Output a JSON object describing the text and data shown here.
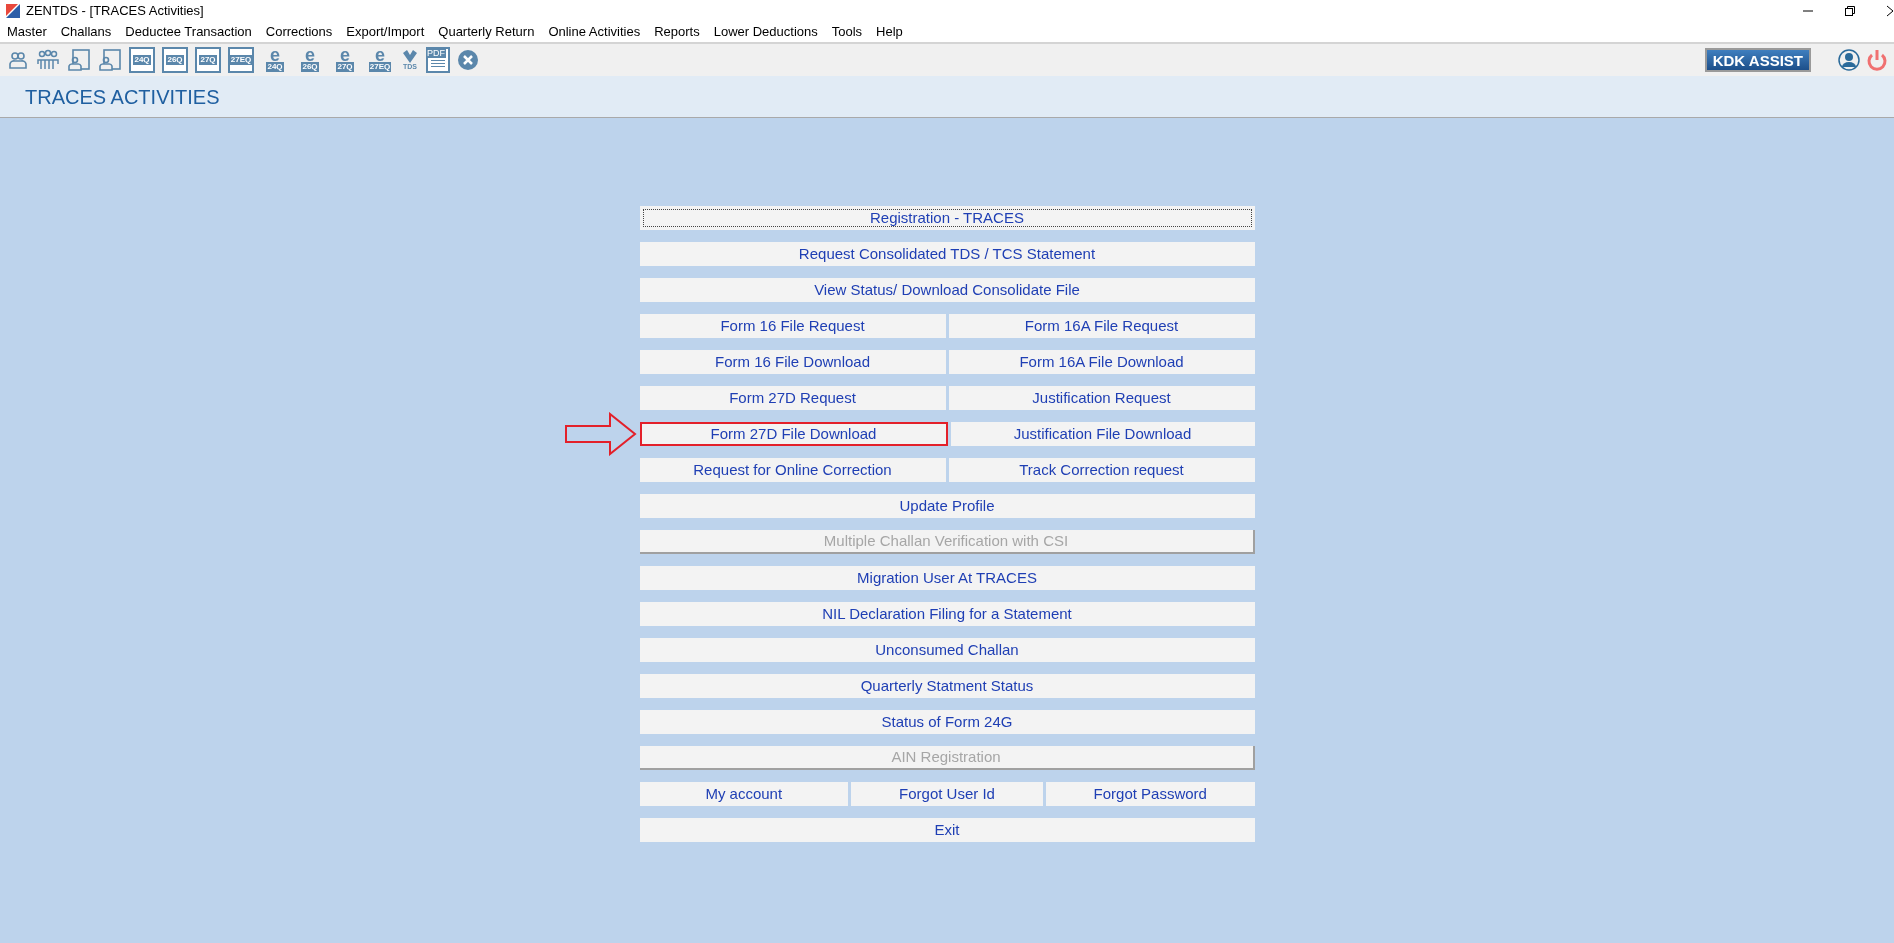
{
  "window": {
    "title": "ZENTDS - [TRACES Activities]"
  },
  "menu": [
    "Master",
    "Challans",
    "Deductee Transaction",
    "Corrections",
    "Export/Import",
    "Quarterly Return",
    "Online Activities",
    "Reports",
    "Lower Deductions",
    "Tools",
    "Help"
  ],
  "toolbar": [
    {
      "kind": "person"
    },
    {
      "kind": "people"
    },
    {
      "kind": "contact"
    },
    {
      "kind": "contact"
    },
    {
      "kind": "form",
      "label": "24Q"
    },
    {
      "kind": "form",
      "label": "26Q"
    },
    {
      "kind": "form",
      "label": "27Q"
    },
    {
      "kind": "form",
      "label": "27EQ"
    },
    {
      "kind": "eform",
      "mark": "e",
      "label": "24Q"
    },
    {
      "kind": "eform",
      "mark": "e",
      "label": "26Q"
    },
    {
      "kind": "eform",
      "mark": "e",
      "label": "27Q"
    },
    {
      "kind": "eform",
      "mark": "e",
      "label": "27EQ"
    },
    {
      "kind": "tds",
      "label": "TDS"
    },
    {
      "kind": "pdf",
      "label": "PDF"
    },
    {
      "kind": "close"
    }
  ],
  "assist_button": "KDK ASSIST",
  "header": {
    "title": "TRACES ACTIVITIES"
  },
  "rows": [
    {
      "buttons": [
        {
          "label": "Registration - TRACES",
          "disabled": false,
          "focused": true,
          "highlighted": false
        }
      ]
    },
    {
      "buttons": [
        {
          "label": "Request Consolidated TDS / TCS Statement",
          "disabled": false,
          "focused": false,
          "highlighted": false
        }
      ]
    },
    {
      "buttons": [
        {
          "label": "View Status/ Download Consolidate File",
          "disabled": false,
          "focused": false,
          "highlighted": false
        }
      ]
    },
    {
      "buttons": [
        {
          "label": "Form 16 File Request",
          "disabled": false,
          "focused": false,
          "highlighted": false
        },
        {
          "label": "Form 16A File Request",
          "disabled": false,
          "focused": false,
          "highlighted": false
        }
      ]
    },
    {
      "buttons": [
        {
          "label": "Form 16 File Download",
          "disabled": false,
          "focused": false,
          "highlighted": false
        },
        {
          "label": "Form 16A File Download",
          "disabled": false,
          "focused": false,
          "highlighted": false
        }
      ]
    },
    {
      "buttons": [
        {
          "label": "Form 27D Request",
          "disabled": false,
          "focused": false,
          "highlighted": false
        },
        {
          "label": "Justification Request",
          "disabled": false,
          "focused": false,
          "highlighted": false
        }
      ]
    },
    {
      "buttons": [
        {
          "label": "Form 27D File Download",
          "disabled": false,
          "focused": false,
          "highlighted": true
        },
        {
          "label": "Justification File Download",
          "disabled": false,
          "focused": false,
          "highlighted": false
        }
      ]
    },
    {
      "buttons": [
        {
          "label": "Request for Online Correction",
          "disabled": false,
          "focused": false,
          "highlighted": false
        },
        {
          "label": "Track Correction request",
          "disabled": false,
          "focused": false,
          "highlighted": false
        }
      ]
    },
    {
      "buttons": [
        {
          "label": "Update Profile",
          "disabled": false,
          "focused": false,
          "highlighted": false
        }
      ]
    },
    {
      "buttons": [
        {
          "label": "Multiple Challan Verification with CSI",
          "disabled": true,
          "focused": false,
          "highlighted": false
        }
      ]
    },
    {
      "buttons": [
        {
          "label": "Migration User At TRACES",
          "disabled": false,
          "focused": false,
          "highlighted": false
        }
      ]
    },
    {
      "buttons": [
        {
          "label": "NIL Declaration Filing for a Statement",
          "disabled": false,
          "focused": false,
          "highlighted": false
        }
      ]
    },
    {
      "buttons": [
        {
          "label": "Unconsumed Challan",
          "disabled": false,
          "focused": false,
          "highlighted": false
        }
      ]
    },
    {
      "buttons": [
        {
          "label": "Quarterly Statment Status",
          "disabled": false,
          "focused": false,
          "highlighted": false
        }
      ]
    },
    {
      "buttons": [
        {
          "label": "Status of Form 24G",
          "disabled": false,
          "focused": false,
          "highlighted": false
        }
      ]
    },
    {
      "buttons": [
        {
          "label": "AIN Registration",
          "disabled": true,
          "focused": false,
          "highlighted": false
        }
      ]
    },
    {
      "buttons": [
        {
          "label": "My account",
          "disabled": false,
          "focused": false,
          "highlighted": false
        },
        {
          "label": "Forgot User Id",
          "disabled": false,
          "focused": false,
          "highlighted": false
        },
        {
          "label": "Forgot Password",
          "disabled": false,
          "focused": false,
          "highlighted": false
        }
      ]
    },
    {
      "buttons": [
        {
          "label": "Exit",
          "disabled": false,
          "focused": false,
          "highlighted": false
        }
      ]
    }
  ]
}
